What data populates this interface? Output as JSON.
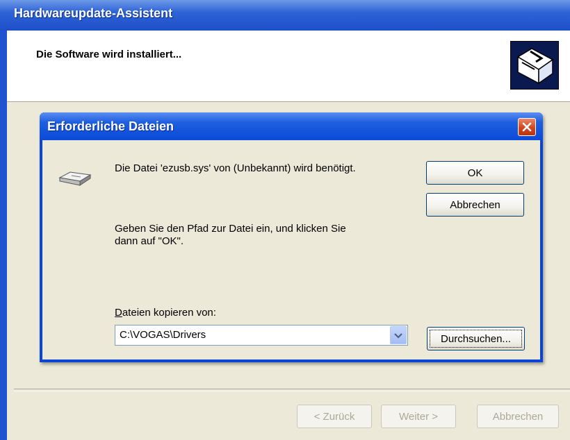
{
  "wizard": {
    "title": "Hardwareupdate-Assistent",
    "heading": "Die Software wird installiert...",
    "header_icon": "hardware-install-icon",
    "buttons": {
      "back": "< Zurück",
      "next": "Weiter >",
      "cancel": "Abbrechen"
    }
  },
  "dialog": {
    "title": "Erforderliche Dateien",
    "close_icon": "close-icon",
    "file_icon": "disk-drive-icon",
    "message": "Die Datei 'ezusb.sys' von (Unbekannt) wird benötigt.",
    "instruction_line1": "Geben Sie den Pfad zur Datei ein, und klicken Sie",
    "instruction_line2": "dann auf \"OK\".",
    "copy_from_label": "Dateien kopieren von:",
    "copy_from_value": "C:\\VOGAS\\Drivers",
    "buttons": {
      "ok": "OK",
      "cancel": "Abbrechen",
      "browse": "Durchsuchen..."
    }
  },
  "colors": {
    "title_blue": "#1f53d0",
    "close_red": "#d1471f",
    "face": "#ece9d8"
  }
}
